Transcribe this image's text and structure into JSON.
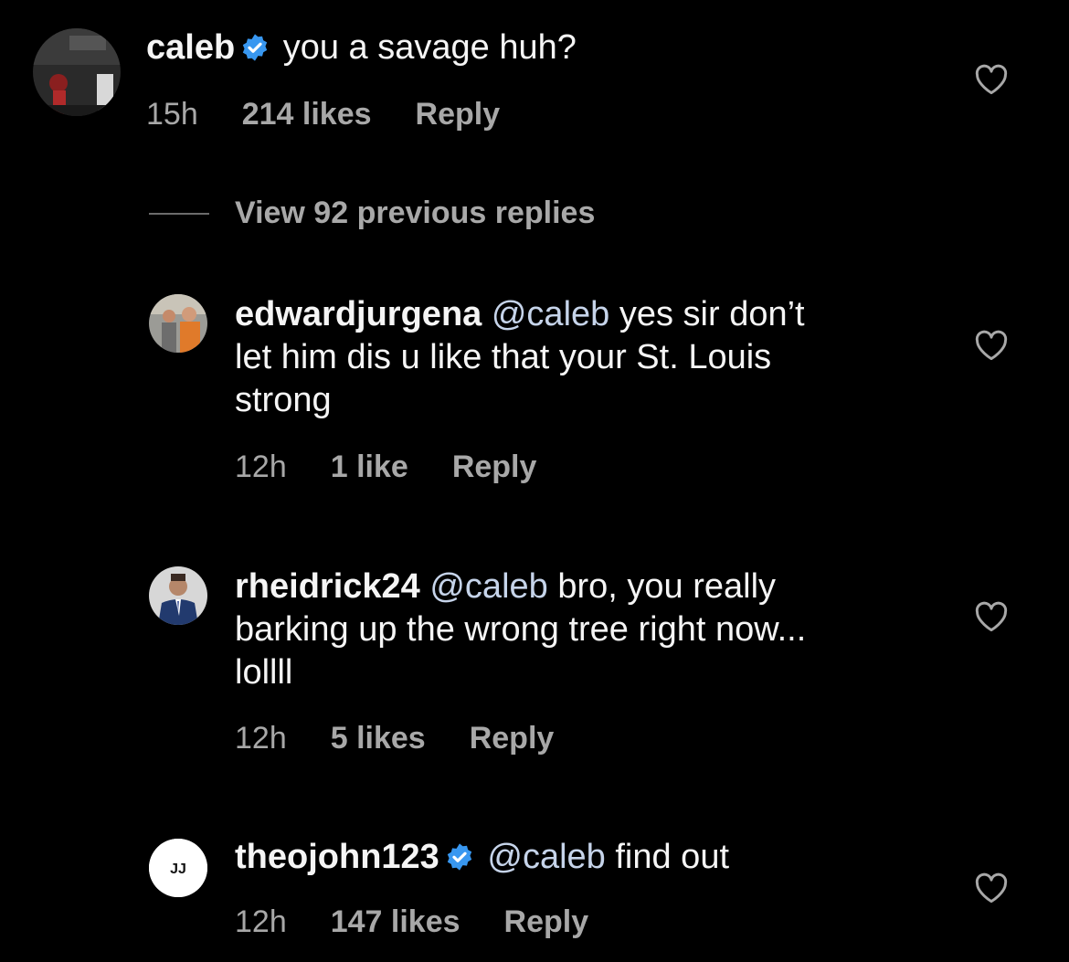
{
  "comments": [
    {
      "username": "caleb",
      "verified": true,
      "text": "you a savage huh?",
      "time": "15h",
      "likes": "214 likes",
      "reply": "Reply"
    },
    {
      "username": "edwardjurgena",
      "mention": "@caleb",
      "text_line1": "yes sir don’t",
      "text_line2": "let him dis u like that your St. Louis",
      "text_line3": "strong",
      "time": "12h",
      "likes": "1 like",
      "reply": "Reply"
    },
    {
      "username": "rheidrick24",
      "mention": "@caleb",
      "text_line1": "bro, you really",
      "text_line2": "barking up the wrong tree right now...",
      "text_line3": "lollll",
      "time": "12h",
      "likes": "5 likes",
      "reply": "Reply"
    },
    {
      "username": "theojohn123",
      "verified": true,
      "mention": "@caleb",
      "text": "find out",
      "time": "12h",
      "likes": "147 likes",
      "reply": "Reply",
      "avatar_logo": "JJ"
    }
  ],
  "view_replies": "View 92 previous replies",
  "colors": {
    "background": "#000000",
    "verified": "#3897f0",
    "secondary": "#a8a8a8"
  }
}
